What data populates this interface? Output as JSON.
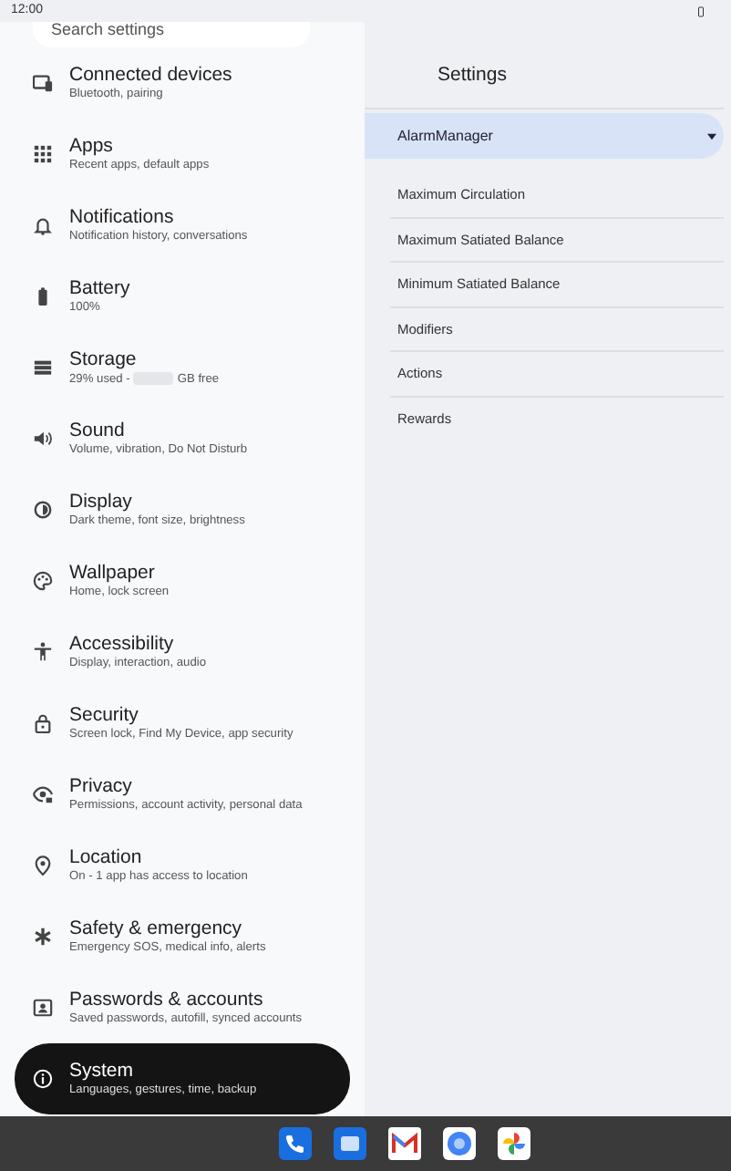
{
  "status_bar": {
    "time": "12:00"
  },
  "search": {
    "placeholder": "Search settings"
  },
  "settings_list": [
    {
      "title": "Connected devices",
      "subtitle": "Bluetooth, pairing",
      "selected": false
    },
    {
      "title": "Apps",
      "subtitle": "Recent apps, default apps",
      "selected": false
    },
    {
      "title": "Notifications",
      "subtitle": "Notification history, conversations",
      "selected": false
    },
    {
      "title": "Battery",
      "subtitle": "100%",
      "selected": false
    },
    {
      "title": "Storage",
      "subtitle": "29% used -",
      "subtitle_end": "GB free",
      "selected": false
    },
    {
      "title": "Sound",
      "subtitle": "Volume, vibration, Do Not Disturb",
      "selected": false
    },
    {
      "title": "Display",
      "subtitle": "Dark theme, font size, brightness",
      "selected": false
    },
    {
      "title": "Wallpaper",
      "subtitle": "Home, lock screen",
      "selected": false
    },
    {
      "title": "Accessibility",
      "subtitle": "Display, interaction, audio",
      "selected": false
    },
    {
      "title": "Security",
      "subtitle": "Screen lock, Find My Device, app security",
      "selected": false
    },
    {
      "title": "Privacy",
      "subtitle": "Permissions, account activity, personal data",
      "selected": false
    },
    {
      "title": "Location",
      "subtitle": "On - 1 app has access to location",
      "selected": false
    },
    {
      "title": "Safety & emergency",
      "subtitle": "Emergency SOS, medical info, alerts",
      "selected": false
    },
    {
      "title": "Passwords & accounts",
      "subtitle": "Saved passwords, autofill, synced accounts",
      "selected": false
    },
    {
      "title": "System",
      "subtitle": "Languages, gestures, time, backup",
      "selected": true
    }
  ],
  "detail": {
    "title": "Settings",
    "dropdown": {
      "value": "AlarmManager"
    },
    "items": [
      "Maximum Circulation",
      "Maximum Satiated Balance",
      "Minimum Satiated Balance",
      "Modifiers",
      "Actions",
      "Rewards"
    ]
  }
}
